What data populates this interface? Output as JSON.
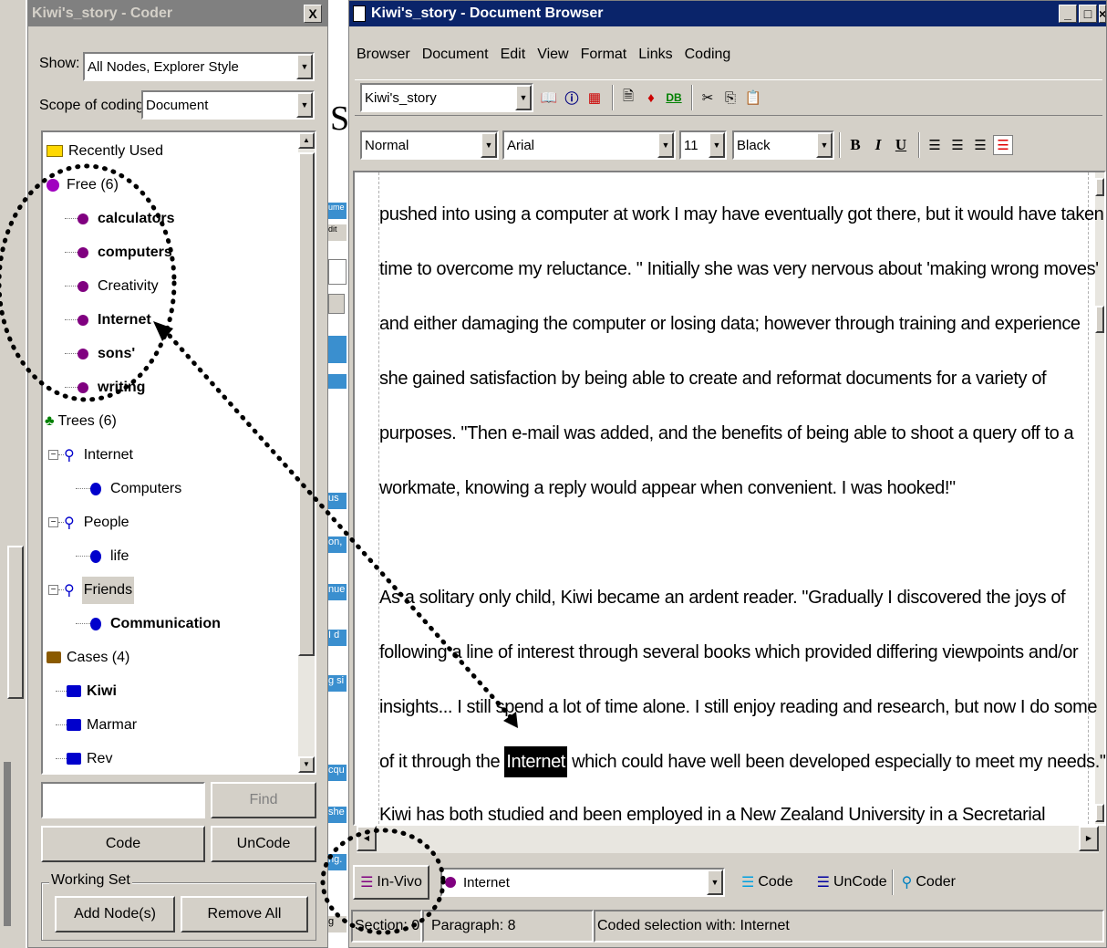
{
  "coder": {
    "title": "Kiwi's_story - Coder",
    "close_label": "X",
    "show_label": "Show:",
    "show_value": "All Nodes, Explorer Style",
    "scope_label": "Scope of coding:",
    "scope_value": "Document",
    "tree": {
      "recently_used": "Recently Used",
      "free": "Free (6)",
      "free_items": [
        "calculators",
        "computers",
        "Creativity",
        "Internet",
        "sons'",
        "writing"
      ],
      "trees": "Trees (6)",
      "tree_internet": "Internet",
      "tree_computers": "Computers",
      "tree_people": "People",
      "tree_life": "life",
      "tree_friends": "Friends",
      "tree_communication": "Communication",
      "cases": "Cases (4)",
      "case_kiwi": "Kiwi",
      "case_marmar": "Marmar",
      "case_rev": "Rev"
    },
    "find_value": "",
    "find_label": "Find",
    "code_label": "Code",
    "uncode_label": "UnCode",
    "working_set_label": "Working Set",
    "add_nodes_label": "Add Node(s)",
    "remove_all_label": "Remove All"
  },
  "browser": {
    "title": "Kiwi's_story - Document Browser",
    "menu": [
      "Browser",
      "Document",
      "Edit",
      "View",
      "Format",
      "Links",
      "Coding"
    ],
    "doc_select": "Kiwi's_story",
    "db_label": "DB",
    "style_select": "Normal",
    "font_select": "Arial",
    "size_select": "11",
    "color_select": "Black",
    "bold_label": "B",
    "italic_label": "I",
    "underline_label": "U",
    "doc_lines": [
      "pushed into using a computer at work I may have eventually got there, but it would have taken",
      "time to overcome my reluctance. \" Initially she was very nervous about 'making wrong moves'",
      "and either damaging the computer or losing data; however through training and experience",
      "she gained satisfaction by being able to create and reformat documents for a variety of",
      "purposes. \"Then e-mail was added, and the benefits of being able to shoot a query off to a",
      "workmate, knowing a reply would appear when convenient. I was hooked!\"",
      "",
      "As a solitary only child, Kiwi became an ardent reader. \"Gradually I discovered the joys of",
      "following a line of interest through several books which provided differing viewpoints and/or",
      "insights... I still spend a lot of time alone. I still enjoy reading and research, but now I do some"
    ],
    "line_11_before": "of it through the ",
    "line_11_highlight": "Internet",
    "line_11_after": " which could have well been developed especially to meet my needs.\"",
    "line_12": "Kiwi has both studied and been employed in a New Zealand University in a Secretarial",
    "invivo_label": "In-Vivo",
    "node_select": "Internet",
    "code_label": "Code",
    "uncode_label": "UnCode",
    "coder_label": "Coder",
    "status_section": "Section: 0",
    "status_paragraph": "Paragraph: 8",
    "status_message": "Coded selection with: Internet"
  },
  "background": {
    "big_letter": "S",
    "fragments": [
      "ume",
      "dit",
      "us",
      "on,",
      "nue",
      "I d",
      "g si",
      "cqu",
      "she",
      "ng.",
      "g"
    ]
  },
  "colors": {
    "active_title": "#0a246a",
    "inactive_title": "#808080",
    "window_face": "#d4d0c8",
    "free_node": "#800080",
    "tree_node": "#0000cc",
    "annotation": "#000000"
  }
}
